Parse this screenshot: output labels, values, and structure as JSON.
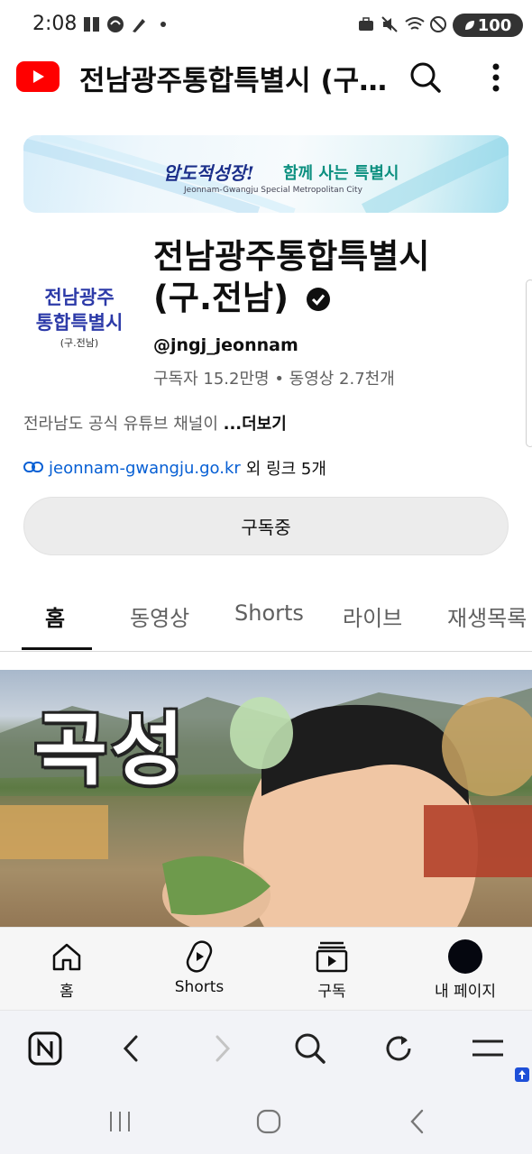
{
  "status_bar": {
    "time": "2:08",
    "battery_level": "100"
  },
  "app_bar": {
    "title": "전남광주통합특별시 (구.전남)"
  },
  "banner": {
    "slogan_italic": "압도적성장!",
    "slogan": "함께 사는 특별시",
    "subtitle": "Jeonnam-Gwangju Special Metropolitan City"
  },
  "channel": {
    "avatar_line1": "전남광주",
    "avatar_line2": "통합특별시",
    "avatar_line3": "(구.전남)",
    "name": "전남광주통합특별시 (구.전남)",
    "handle": "@jngj_jeonnam",
    "stats": "구독자 15.2만명 • 동영상 2.7천개",
    "description": "전라남도 공식 유튜브 채널이 ",
    "more_label": "...더보기",
    "link_url": "jeonnam-gwangju.go.kr",
    "link_more": "외 링크 5개",
    "subscribe_label": "구독중"
  },
  "tabs": [
    {
      "label": "홈",
      "active": true
    },
    {
      "label": "동영상"
    },
    {
      "label": "Shorts"
    },
    {
      "label": "라이브"
    },
    {
      "label": "재생목록"
    }
  ],
  "video": {
    "thumbnail_title": "곡성"
  },
  "bottom_nav": [
    {
      "label": "홈",
      "icon": "home-icon"
    },
    {
      "label": "Shorts",
      "icon": "shorts-icon"
    },
    {
      "label": "구독",
      "icon": "subscriptions-icon"
    },
    {
      "label": "내 페이지",
      "icon": "avatar-icon"
    }
  ],
  "browser_toolbar": [
    "naver-icon",
    "back-icon",
    "forward-icon",
    "search-icon",
    "refresh-icon",
    "menu-icon"
  ],
  "colors": {
    "brand_red": "#ff0000",
    "link_blue": "#065fd4",
    "avatar_blue": "#2c3aa8"
  }
}
